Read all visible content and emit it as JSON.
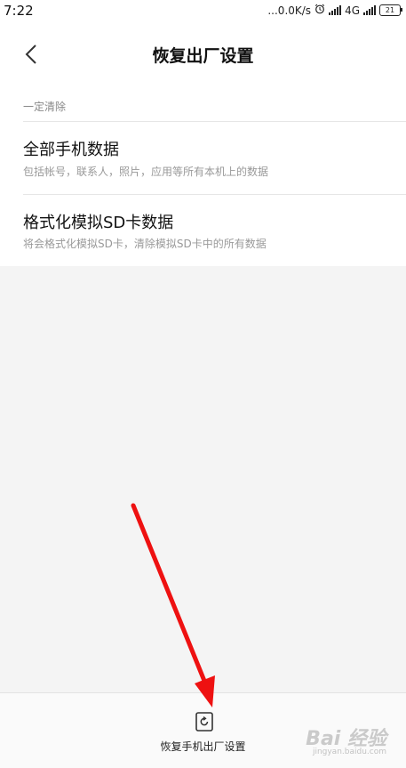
{
  "status_bar": {
    "time": "7:22",
    "network_speed": "...0.0K/s",
    "network_type": "4G",
    "battery_level": "21"
  },
  "header": {
    "title": "恢复出厂设置"
  },
  "section": {
    "label": "一定清除"
  },
  "items": [
    {
      "title": "全部手机数据",
      "description": "包括帐号，联系人，照片，应用等所有本机上的数据"
    },
    {
      "title": "格式化模拟SD卡数据",
      "description": "将会格式化模拟SD卡，清除模拟SD卡中的所有数据"
    }
  ],
  "bottom_action": {
    "label": "恢复手机出厂设置",
    "icon": "restore-phone-icon"
  },
  "annotation": {
    "arrow_color": "#ee1111"
  },
  "watermark": {
    "brand": "Bai 经验",
    "url": "jingyan.baidu.com"
  }
}
